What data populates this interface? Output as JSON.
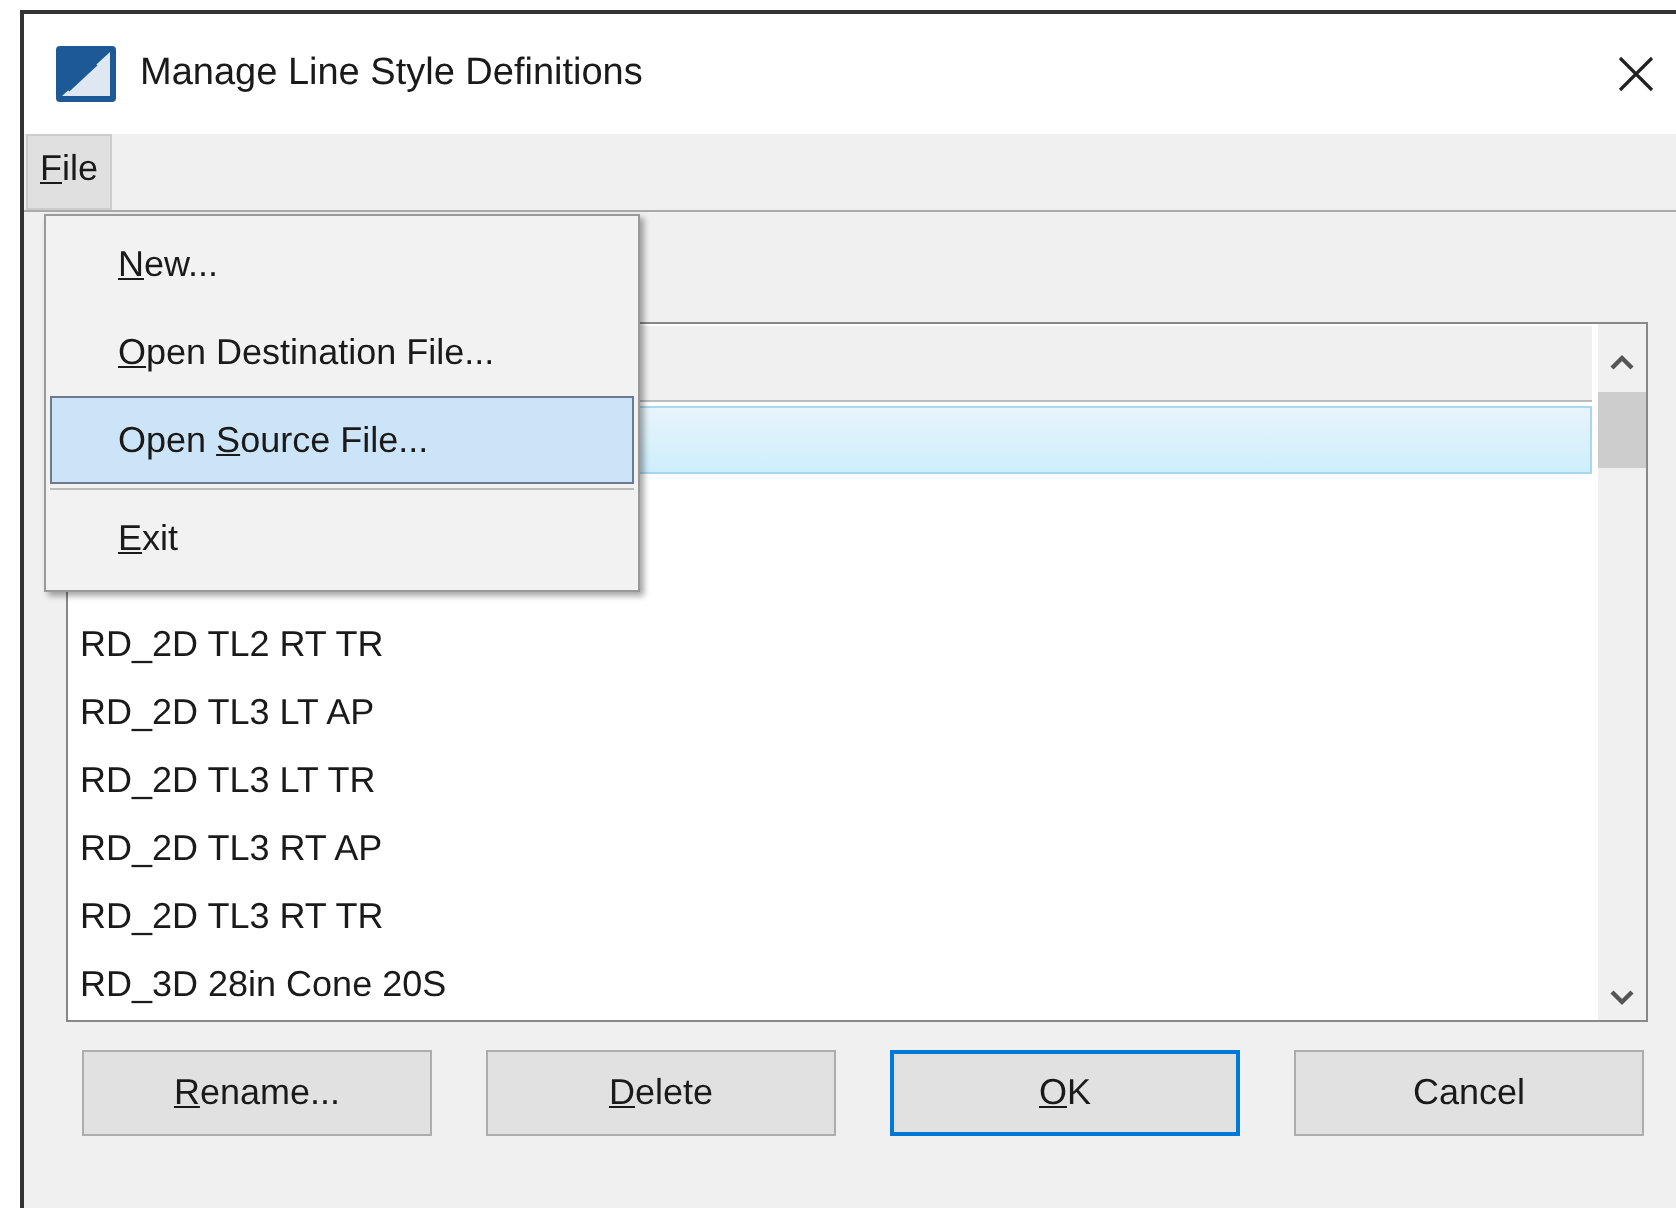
{
  "window": {
    "title": "Manage Line Style Definitions"
  },
  "menubar": [
    {
      "access_key": "F",
      "label_after": "ile",
      "selected": true
    }
  ],
  "menu": [
    {
      "kind": "item",
      "access_key": "N",
      "label_after": "ew...",
      "selected": false
    },
    {
      "kind": "item",
      "access_key": "O",
      "label_after": "pen Destination File...",
      "selected": false
    },
    {
      "kind": "item",
      "label_before": "Open ",
      "access_key": "S",
      "label_after": "ource File...",
      "selected": true
    },
    {
      "kind": "separator"
    },
    {
      "kind": "item",
      "access_key": "E",
      "label_after": "xit",
      "selected": false
    }
  ],
  "list": {
    "rows": [
      {
        "selected": true
      },
      {
        "selected": false
      },
      {
        "selected": false
      },
      {
        "text": "RD_2D TL2 RT TR",
        "selected": false
      },
      {
        "text": "RD_2D TL3 LT AP",
        "selected": false
      },
      {
        "text": "RD_2D TL3 LT TR",
        "selected": false
      },
      {
        "text": "RD_2D TL3 RT AP",
        "selected": false
      },
      {
        "text": "RD_2D TL3 RT TR",
        "selected": false
      },
      {
        "text": "RD_3D 28in Cone 20S",
        "selected": false
      }
    ]
  },
  "buttons": [
    {
      "access_key": "R",
      "label_after": "ename...",
      "default": false
    },
    {
      "access_key": "D",
      "label_after": "elete",
      "default": false
    },
    {
      "access_key": "O",
      "label_after": "K",
      "default": true
    },
    {
      "label_before": "Cancel",
      "default": false
    }
  ]
}
